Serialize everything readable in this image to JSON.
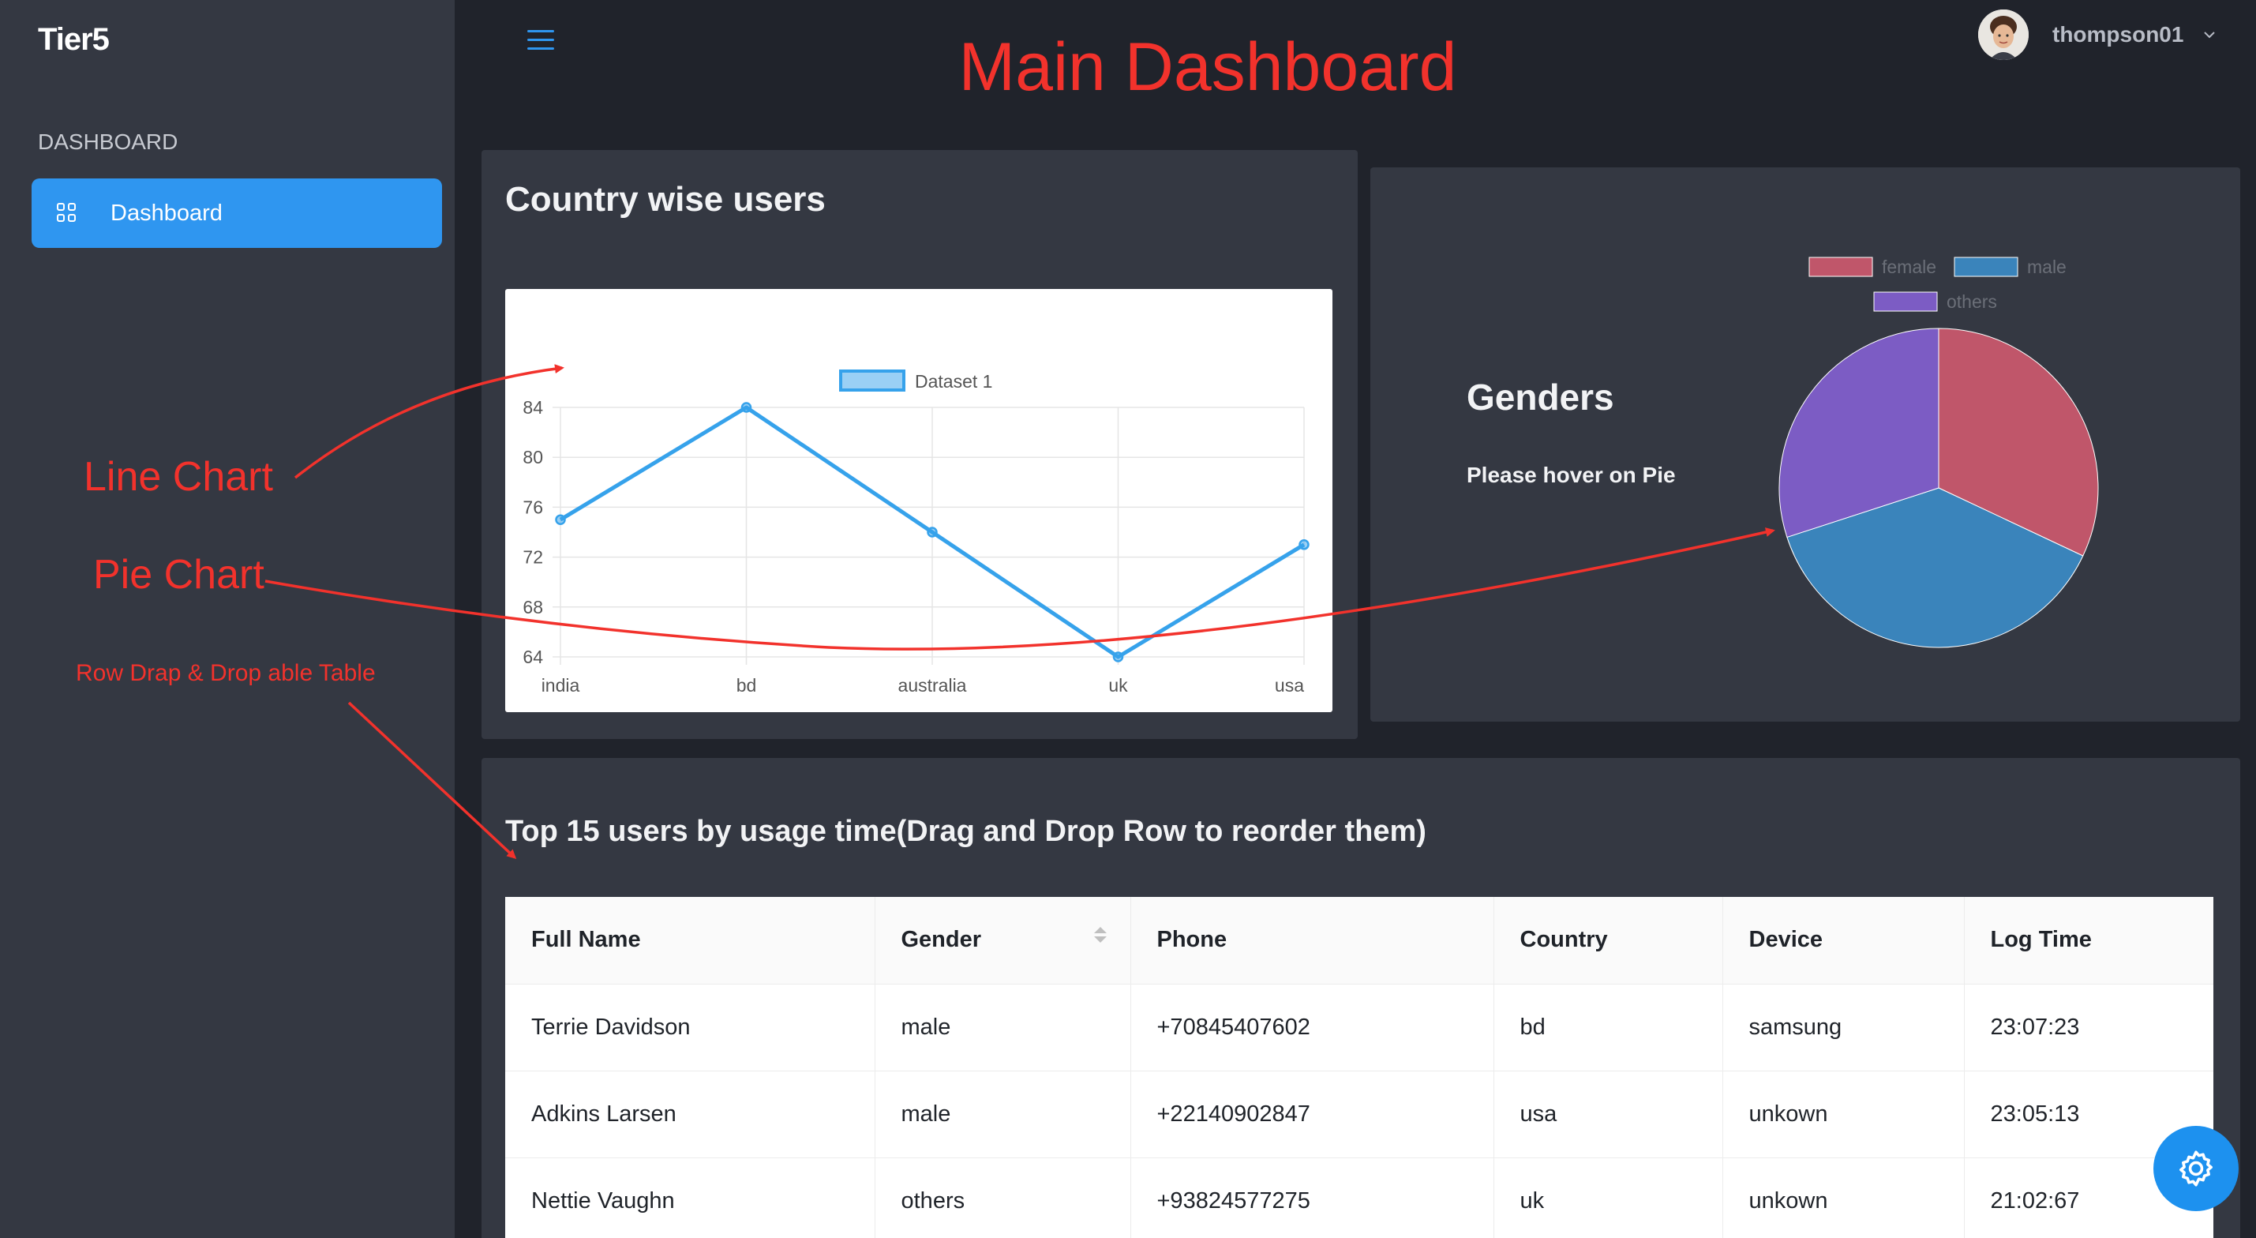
{
  "app": {
    "logo": "Tier5"
  },
  "sidebar": {
    "section_title": "DASHBOARD",
    "items": [
      {
        "label": "Dashboard",
        "icon": "dashboard-grid-icon",
        "active": true
      }
    ]
  },
  "header": {
    "title": "Main Dashboard",
    "menu_icon": "hamburger-menu-icon",
    "user": {
      "name": "thompson01",
      "avatar": "user-avatar",
      "caret_icon": "chevron-down-icon"
    }
  },
  "country_card": {
    "title": "Country wise users",
    "chart_data": {
      "type": "line",
      "categories": [
        "india",
        "bd",
        "australia",
        "uk",
        "usa"
      ],
      "series": [
        {
          "name": "Dataset 1",
          "values": [
            75,
            84,
            74,
            64,
            73
          ]
        }
      ],
      "ylim": [
        64,
        84
      ],
      "yticks": [
        64,
        68,
        72,
        76,
        80,
        84
      ],
      "legend": "top",
      "grid": true,
      "color": "#36a2eb"
    }
  },
  "genders_card": {
    "title": "Genders",
    "hint": "Please hover on Pie",
    "chart_data": {
      "type": "pie",
      "labels": [
        "female",
        "male",
        "others"
      ],
      "values": [
        32,
        38,
        30
      ],
      "colors": [
        "#c0566a",
        "#3a84bb",
        "#7c5cc4"
      ],
      "legend": "top"
    }
  },
  "users_table": {
    "title": "Top 15 users by usage time(Drag and Drop Row to reorder them)",
    "columns": [
      "Full Name",
      "Gender",
      "Phone",
      "Country",
      "Device",
      "Log Time"
    ],
    "rows": [
      [
        "Terrie Davidson",
        "male",
        "+70845407602",
        "bd",
        "samsung",
        "23:07:23"
      ],
      [
        "Adkins Larsen",
        "male",
        "+22140902847",
        "usa",
        "unkown",
        "23:05:13"
      ],
      [
        "Nettie Vaughn",
        "others",
        "+93824577275",
        "uk",
        "unkown",
        "21:02:67"
      ]
    ]
  },
  "annotations": {
    "line_chart": "Line Chart",
    "pie_chart": "Pie Chart",
    "table": "Row Drap & Drop able Table",
    "color": "#f2322c"
  },
  "fab": {
    "icon": "settings-gear-icon"
  }
}
